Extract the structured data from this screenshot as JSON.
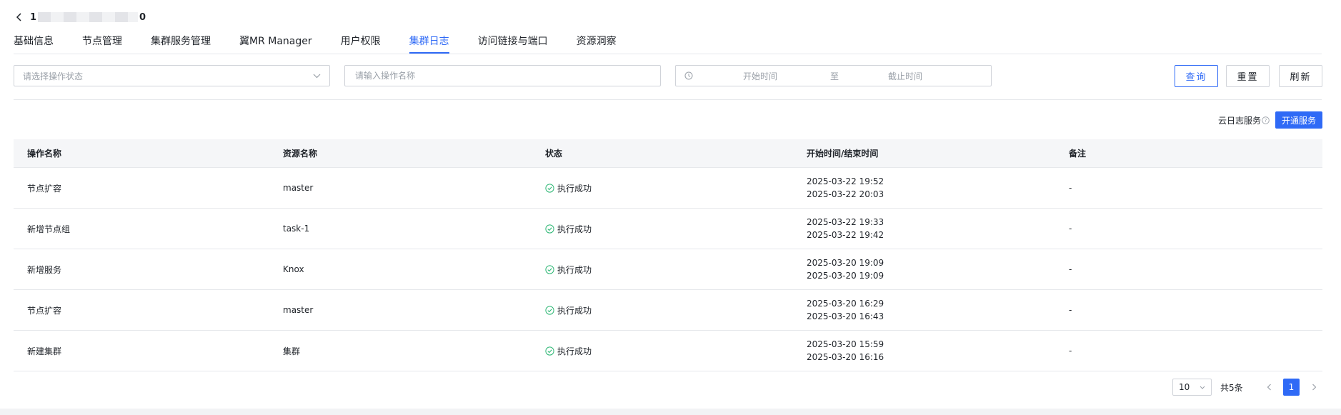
{
  "header": {
    "title_prefix": "1",
    "title_suffix": "0"
  },
  "tabs": [
    {
      "label": "基础信息",
      "active": false
    },
    {
      "label": "节点管理",
      "active": false
    },
    {
      "label": "集群服务管理",
      "active": false
    },
    {
      "label": "翼MR Manager",
      "active": false
    },
    {
      "label": "用户权限",
      "active": false
    },
    {
      "label": "集群日志",
      "active": true
    },
    {
      "label": "访问链接与端口",
      "active": false
    },
    {
      "label": "资源洞察",
      "active": false
    }
  ],
  "filters": {
    "status_placeholder": "请选择操作状态",
    "name_placeholder": "请输入操作名称",
    "start_placeholder": "开始时间",
    "range_sep": "至",
    "end_placeholder": "截止时间"
  },
  "buttons": {
    "query": "查询",
    "reset": "重置",
    "refresh": "刷新"
  },
  "cloud_log": {
    "label": "云日志服务",
    "open_button": "开通服务"
  },
  "table": {
    "columns": [
      "操作名称",
      "资源名称",
      "状态",
      "开始时间/结束时间",
      "备注"
    ],
    "rows": [
      {
        "op": "节点扩容",
        "resource": "master",
        "status": "执行成功",
        "start": "2025-03-22 19:52",
        "end": "2025-03-22 20:03",
        "note": "-"
      },
      {
        "op": "新增节点组",
        "resource": "task-1",
        "status": "执行成功",
        "start": "2025-03-22 19:33",
        "end": "2025-03-22 19:42",
        "note": "-"
      },
      {
        "op": "新增服务",
        "resource": "Knox",
        "status": "执行成功",
        "start": "2025-03-20 19:09",
        "end": "2025-03-20 19:09",
        "note": "-"
      },
      {
        "op": "节点扩容",
        "resource": "master",
        "status": "执行成功",
        "start": "2025-03-20 16:29",
        "end": "2025-03-20 16:43",
        "note": "-"
      },
      {
        "op": "新建集群",
        "resource": "集群",
        "status": "执行成功",
        "start": "2025-03-20 15:59",
        "end": "2025-03-20 16:16",
        "note": "-"
      }
    ]
  },
  "pagination": {
    "page_size": "10",
    "total": "共5条",
    "current": "1"
  },
  "colors": {
    "primary": "#2f6af6",
    "success": "#2bb673",
    "border": "#d0d3d9"
  }
}
